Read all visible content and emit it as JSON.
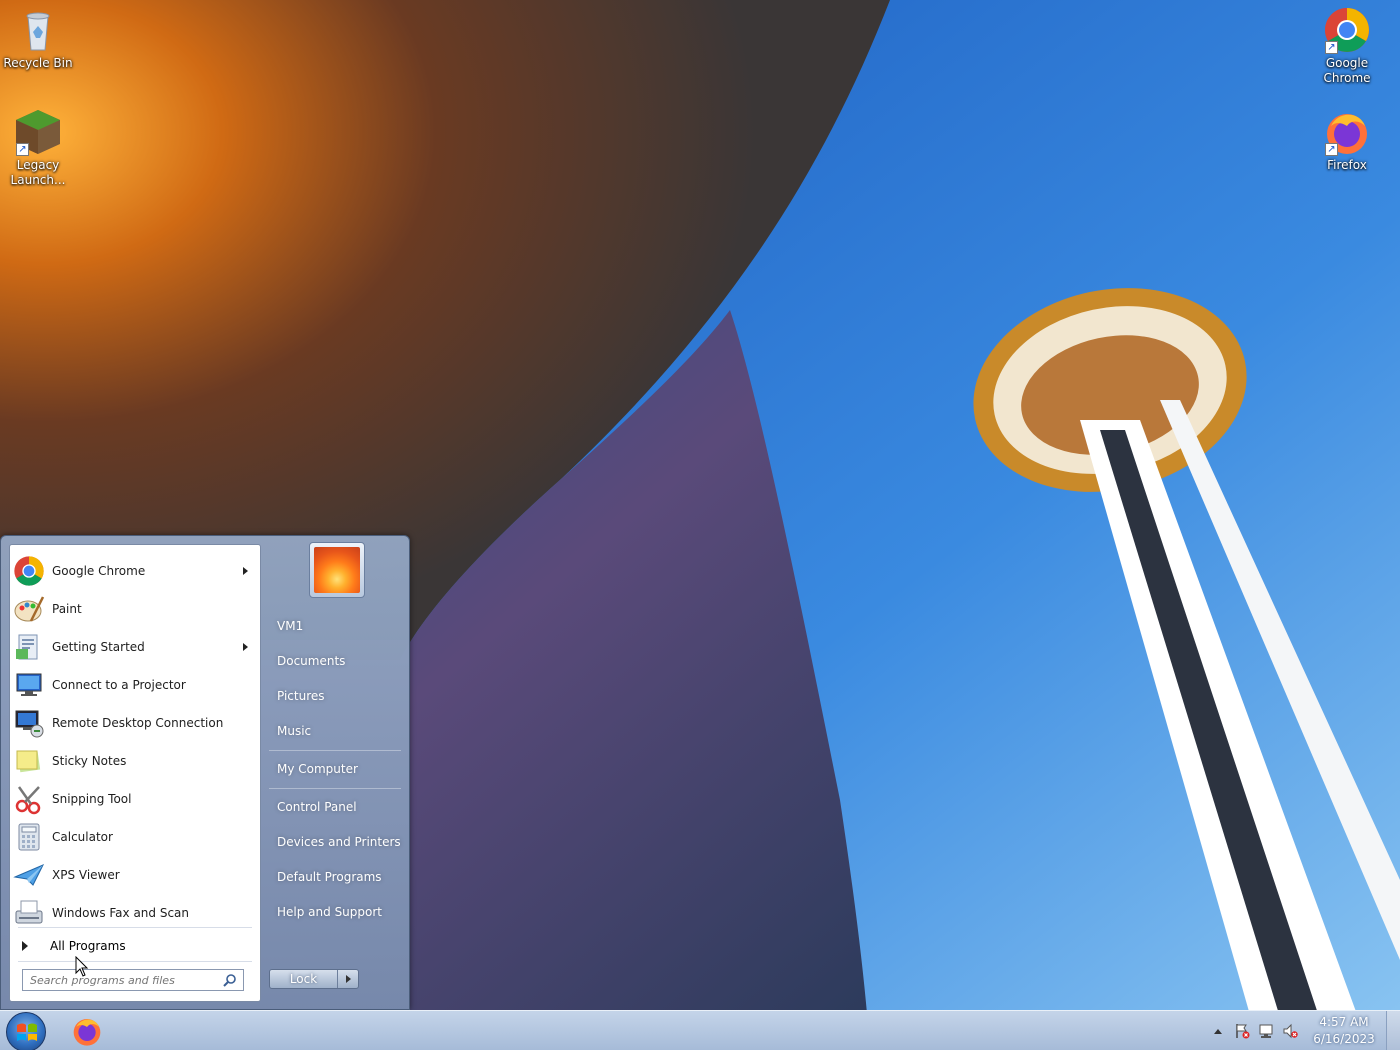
{
  "desktop_icons": [
    {
      "label": "Recycle Bin",
      "icon": "recycle-bin-icon"
    },
    {
      "label": "Legacy Launch...",
      "icon": "minecraft-icon"
    },
    {
      "label": "Google Chrome",
      "icon": "chrome-icon"
    },
    {
      "label": "Firefox",
      "icon": "firefox-icon"
    }
  ],
  "start_menu": {
    "programs": [
      {
        "label": "Google Chrome",
        "icon": "chrome-icon",
        "has_submenu": true
      },
      {
        "label": "Paint",
        "icon": "paint-icon",
        "has_submenu": false
      },
      {
        "label": "Getting Started",
        "icon": "getting-started-icon",
        "has_submenu": true
      },
      {
        "label": "Connect to a Projector",
        "icon": "projector-icon",
        "has_submenu": false
      },
      {
        "label": "Remote Desktop Connection",
        "icon": "remote-desktop-icon",
        "has_submenu": false
      },
      {
        "label": "Sticky Notes",
        "icon": "sticky-notes-icon",
        "has_submenu": false
      },
      {
        "label": "Snipping Tool",
        "icon": "snipping-tool-icon",
        "has_submenu": false
      },
      {
        "label": "Calculator",
        "icon": "calculator-icon",
        "has_submenu": false
      },
      {
        "label": "XPS Viewer",
        "icon": "xps-viewer-icon",
        "has_submenu": false
      },
      {
        "label": "Windows Fax and Scan",
        "icon": "fax-scan-icon",
        "has_submenu": false
      }
    ],
    "all_programs_label": "All Programs",
    "search_placeholder": "Search programs and files",
    "right_links": [
      "VM1",
      "Documents",
      "Pictures",
      "Music",
      "My Computer",
      "Control Panel",
      "Devices and Printers",
      "Default Programs",
      "Help and Support"
    ],
    "lock_label": "Lock"
  },
  "taskbar": {
    "pinned": [
      {
        "icon": "firefox-icon"
      }
    ],
    "tray_icons": [
      "show-hidden-icons-icon",
      "action-center-flag-icon",
      "network-icon",
      "volume-muted-icon"
    ],
    "clock_time": "4:57 AM",
    "clock_date": "6/16/2023"
  }
}
